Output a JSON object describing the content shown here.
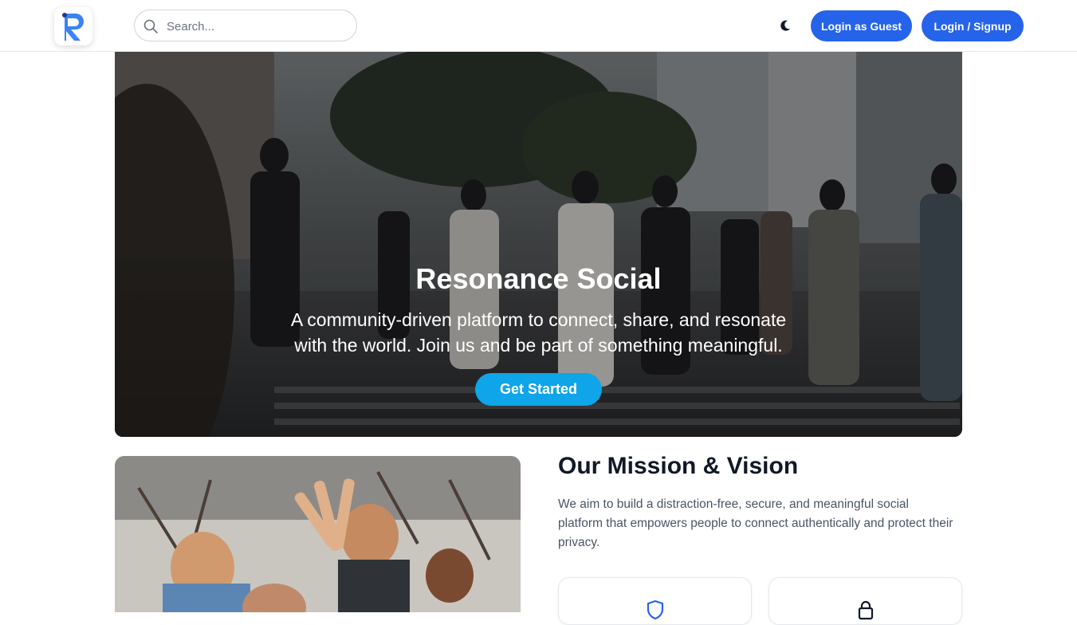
{
  "header": {
    "logo_icon": "resonance-logo-icon",
    "search": {
      "placeholder": "Search...",
      "value": ""
    },
    "theme_toggle_icon": "moon-icon",
    "guest_button": "Login as Guest",
    "login_button": "Login / Signup"
  },
  "hero": {
    "title": "Resonance Social",
    "subtitle": "A community-driven platform to connect, share, and resonate with the world. Join us and be part of something meaningful.",
    "cta": "Get Started"
  },
  "mission": {
    "title": "Our Mission & Vision",
    "text": "We aim to build a distraction-free, secure, and meaningful social platform that empowers people to connect authentically and protect their privacy.",
    "cards": [
      {
        "icon": "shield-icon"
      },
      {
        "icon": "lock-icon"
      }
    ]
  },
  "colors": {
    "primary": "#2563eb",
    "accent": "#0ea5e9",
    "text": "#111827",
    "muted": "#4b5563"
  }
}
